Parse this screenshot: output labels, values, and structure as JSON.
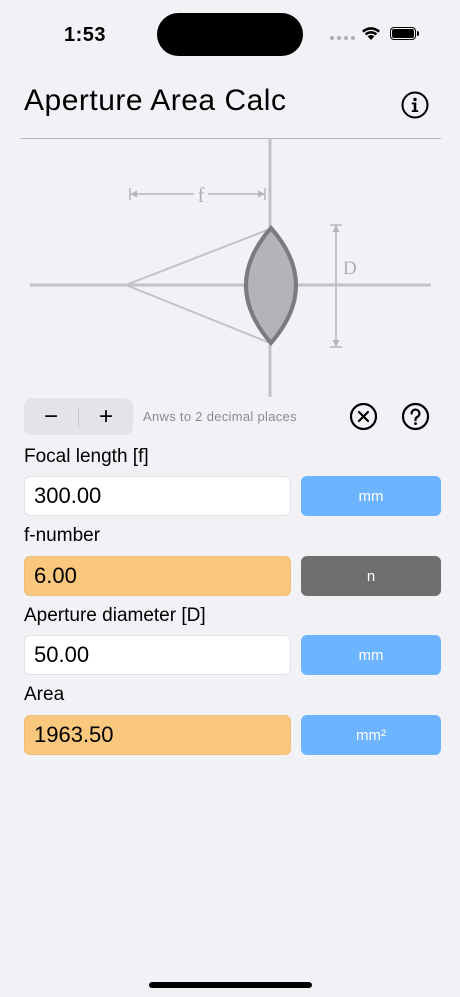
{
  "status": {
    "time": "1:53"
  },
  "header": {
    "title": "Aperture Area Calc"
  },
  "diagram": {
    "label_f": "f",
    "label_d": "D"
  },
  "controls": {
    "minus_label": "−",
    "plus_label": "+",
    "precision_text": "Anws to 2 decimal places"
  },
  "fields": {
    "focal_length": {
      "label": "Focal length [f]",
      "value": "300.00",
      "unit": "mm"
    },
    "f_number": {
      "label": "f-number",
      "value": "6.00",
      "unit": "n"
    },
    "aperture_diameter": {
      "label": "Aperture diameter [D]",
      "value": "50.00",
      "unit": "mm"
    },
    "area": {
      "label": "Area",
      "value": "1963.50",
      "unit": "mm²"
    }
  },
  "colors": {
    "background": "#f2f1f6",
    "input_field": "#ffffff",
    "result_field": "#f9c77d",
    "unit_button": "#6cb4fd",
    "unit_button_selected": "#6f6f6f"
  },
  "icons": [
    "wifi-icon",
    "battery-icon",
    "info-icon",
    "clear-icon",
    "help-icon"
  ]
}
